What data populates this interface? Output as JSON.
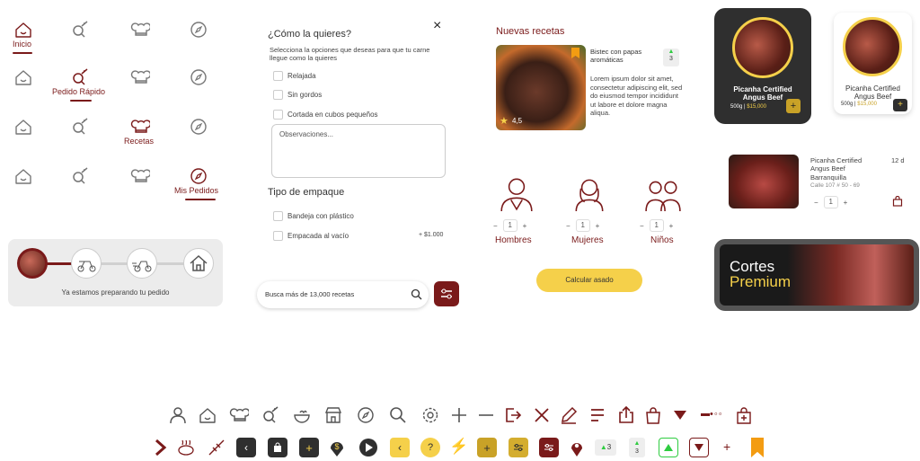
{
  "nav": {
    "inicio": "Inicio",
    "pedido": "Pedido Rápido",
    "recetas": "Recetas",
    "mis_pedidos": "Mis Pedidos"
  },
  "progress": {
    "status": "Ya estamos preparando tu pedido"
  },
  "modal": {
    "title": "¿Cómo la quieres?",
    "close": "×",
    "subtitle": "Selecciona la opciones que deseas para que tu carne llegue como la quieres",
    "options": [
      "Relajada",
      "Sin gordos",
      "Cortada en cubos pequeños"
    ],
    "obs_placeholder": "Observaciones...",
    "pack_title": "Tipo de empaque",
    "pack": [
      {
        "label": "Bandeja con plástico",
        "price": ""
      },
      {
        "label": "Empacada al vacío",
        "price": "+ $1.000"
      }
    ]
  },
  "search": {
    "placeholder": "Busca más de 13,000 recetas"
  },
  "recipes": {
    "title": "Nuevas recetas",
    "name": "Bistec con papas aromáticas",
    "rating": "4,5",
    "count": "3",
    "desc": "Lorem ipsum dolor sit amet, consectetur adipiscing elit, sed do eiusmod tempor incididunt ut labore et dolore magna aliqua."
  },
  "people": [
    {
      "label": "Hombres",
      "qty": "1"
    },
    {
      "label": "Mujeres",
      "qty": "1"
    },
    {
      "label": "Niños",
      "qty": "1"
    }
  ],
  "calc": "Calcular asado",
  "cards": [
    {
      "name": "Picanha Certified Angus Beef",
      "weight": "500g",
      "price": "$15,000"
    },
    {
      "name": "Picanha Certified Angus Beef",
      "weight": "500g",
      "price": "$15,000"
    }
  ],
  "order": {
    "name": "Picanha Certified Angus Beef",
    "city": "Barranquilla",
    "address": "Calle 107 # 50 - 69",
    "days": "12 d",
    "qty": "1"
  },
  "banner": {
    "line1": "Cortes",
    "line2": "Premium"
  },
  "icons": {
    "badge1": "3",
    "badge2": "3",
    "dots": "•◦◦",
    "plus": "+",
    "minus": "−",
    "bolt": "⚡",
    "q": "?"
  },
  "colors": {
    "maroon": "#7a1a1a",
    "gold": "#f5d04a",
    "dark": "#2f2f2f"
  }
}
